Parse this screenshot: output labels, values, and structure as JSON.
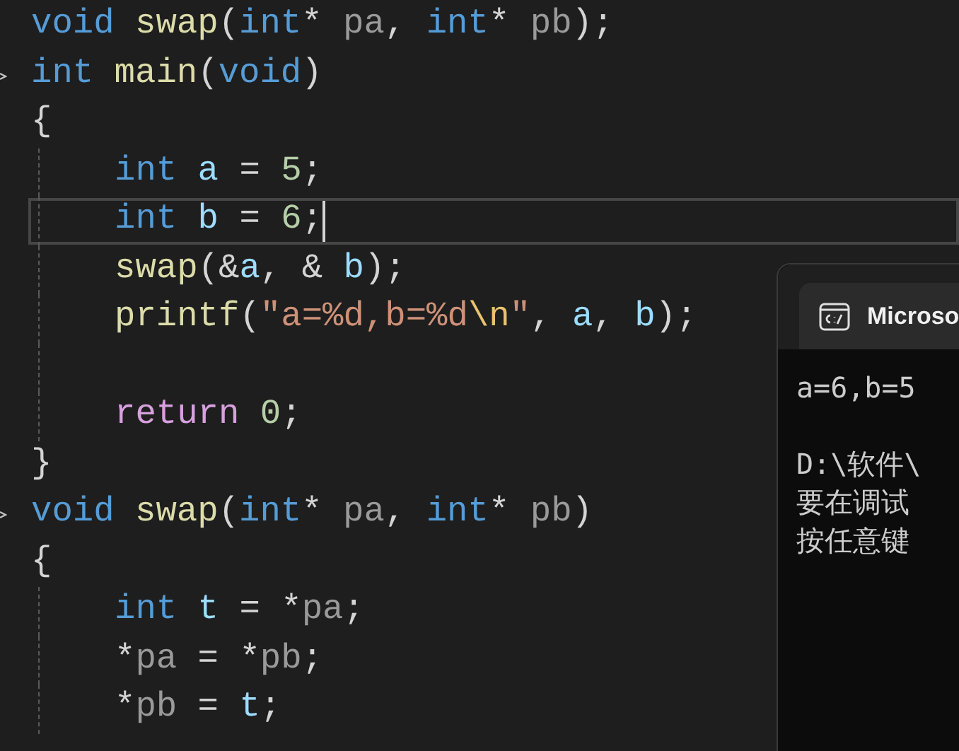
{
  "editor": {
    "lines": [
      {
        "foldable": false,
        "current": false,
        "indented": false,
        "tokens": [
          {
            "text": "void",
            "kind": "keyword"
          },
          {
            "text": " swap",
            "kind": "function"
          },
          {
            "text": "(",
            "kind": "plain"
          },
          {
            "text": "int",
            "kind": "keyword"
          },
          {
            "text": "* ",
            "kind": "plain"
          },
          {
            "text": "pa",
            "kind": "param"
          },
          {
            "text": ", ",
            "kind": "plain"
          },
          {
            "text": "int",
            "kind": "keyword"
          },
          {
            "text": "* ",
            "kind": "plain"
          },
          {
            "text": "pb",
            "kind": "param"
          },
          {
            "text": ");",
            "kind": "plain"
          }
        ]
      },
      {
        "foldable": true,
        "current": false,
        "indented": false,
        "tokens": [
          {
            "text": "int",
            "kind": "keyword"
          },
          {
            "text": " main",
            "kind": "function"
          },
          {
            "text": "(",
            "kind": "plain"
          },
          {
            "text": "void",
            "kind": "keyword"
          },
          {
            "text": ")",
            "kind": "plain"
          }
        ]
      },
      {
        "foldable": false,
        "current": false,
        "indented": false,
        "tokens": [
          {
            "text": "{",
            "kind": "plain"
          }
        ]
      },
      {
        "foldable": false,
        "current": false,
        "indented": true,
        "tokens": [
          {
            "text": "int",
            "kind": "keyword"
          },
          {
            "text": " a",
            "kind": "variable"
          },
          {
            "text": " = ",
            "kind": "plain"
          },
          {
            "text": "5",
            "kind": "number"
          },
          {
            "text": ";",
            "kind": "plain"
          }
        ]
      },
      {
        "foldable": false,
        "current": true,
        "indented": true,
        "tokens": [
          {
            "text": "int",
            "kind": "keyword"
          },
          {
            "text": " b",
            "kind": "variable"
          },
          {
            "text": " = ",
            "kind": "plain"
          },
          {
            "text": "6",
            "kind": "number"
          },
          {
            "text": ";",
            "kind": "plain"
          }
        ]
      },
      {
        "foldable": false,
        "current": false,
        "indented": true,
        "tokens": [
          {
            "text": "swap",
            "kind": "function"
          },
          {
            "text": "(&",
            "kind": "plain"
          },
          {
            "text": "a",
            "kind": "variable"
          },
          {
            "text": ", & ",
            "kind": "plain"
          },
          {
            "text": "b",
            "kind": "variable"
          },
          {
            "text": ");",
            "kind": "plain"
          }
        ]
      },
      {
        "foldable": false,
        "current": false,
        "indented": true,
        "tokens": [
          {
            "text": "printf",
            "kind": "function"
          },
          {
            "text": "(",
            "kind": "plain"
          },
          {
            "text": "\"a=%d,b=%d",
            "kind": "string"
          },
          {
            "text": "\\n",
            "kind": "escape"
          },
          {
            "text": "\"",
            "kind": "string"
          },
          {
            "text": ", ",
            "kind": "plain"
          },
          {
            "text": "a",
            "kind": "variable"
          },
          {
            "text": ", ",
            "kind": "plain"
          },
          {
            "text": "b",
            "kind": "variable"
          },
          {
            "text": ");",
            "kind": "plain"
          }
        ]
      },
      {
        "foldable": false,
        "current": false,
        "indented": true
      },
      {
        "foldable": false,
        "current": false,
        "indented": true,
        "tokens": [
          {
            "text": "return",
            "kind": "control"
          },
          {
            "text": " 0",
            "kind": "number"
          },
          {
            "text": ";",
            "kind": "plain"
          }
        ]
      },
      {
        "foldable": false,
        "current": false,
        "indented": false,
        "tokens": [
          {
            "text": "}",
            "kind": "plain"
          }
        ]
      },
      {
        "foldable": true,
        "current": false,
        "indented": false,
        "tokens": [
          {
            "text": "void",
            "kind": "keyword"
          },
          {
            "text": " swap",
            "kind": "function"
          },
          {
            "text": "(",
            "kind": "plain"
          },
          {
            "text": "int",
            "kind": "keyword"
          },
          {
            "text": "* ",
            "kind": "plain"
          },
          {
            "text": "pa",
            "kind": "param"
          },
          {
            "text": ", ",
            "kind": "plain"
          },
          {
            "text": "int",
            "kind": "keyword"
          },
          {
            "text": "* ",
            "kind": "plain"
          },
          {
            "text": "pb",
            "kind": "param"
          },
          {
            "text": ")",
            "kind": "plain"
          }
        ]
      },
      {
        "foldable": false,
        "current": false,
        "indented": false,
        "tokens": [
          {
            "text": "{",
            "kind": "plain"
          }
        ]
      },
      {
        "foldable": false,
        "current": false,
        "indented": true,
        "tokens": [
          {
            "text": "int",
            "kind": "keyword"
          },
          {
            "text": " t",
            "kind": "variable"
          },
          {
            "text": " = *",
            "kind": "plain"
          },
          {
            "text": "pa",
            "kind": "param"
          },
          {
            "text": ";",
            "kind": "plain"
          }
        ]
      },
      {
        "foldable": false,
        "current": false,
        "indented": true,
        "tokens": [
          {
            "text": "*",
            "kind": "plain"
          },
          {
            "text": "pa",
            "kind": "param"
          },
          {
            "text": " = *",
            "kind": "plain"
          },
          {
            "text": "pb",
            "kind": "param"
          },
          {
            "text": ";",
            "kind": "plain"
          }
        ]
      },
      {
        "foldable": false,
        "current": false,
        "indented": true,
        "tokens": [
          {
            "text": "*",
            "kind": "plain"
          },
          {
            "text": "pb",
            "kind": "param"
          },
          {
            "text": " = ",
            "kind": "plain"
          },
          {
            "text": "t",
            "kind": "variable"
          },
          {
            "text": ";",
            "kind": "plain"
          }
        ]
      }
    ]
  },
  "console": {
    "title": "Microso",
    "blocks": [
      [
        "a=6,b=5"
      ],
      [
        "D:\\软件\\",
        "要在调试",
        "按任意键"
      ]
    ]
  }
}
